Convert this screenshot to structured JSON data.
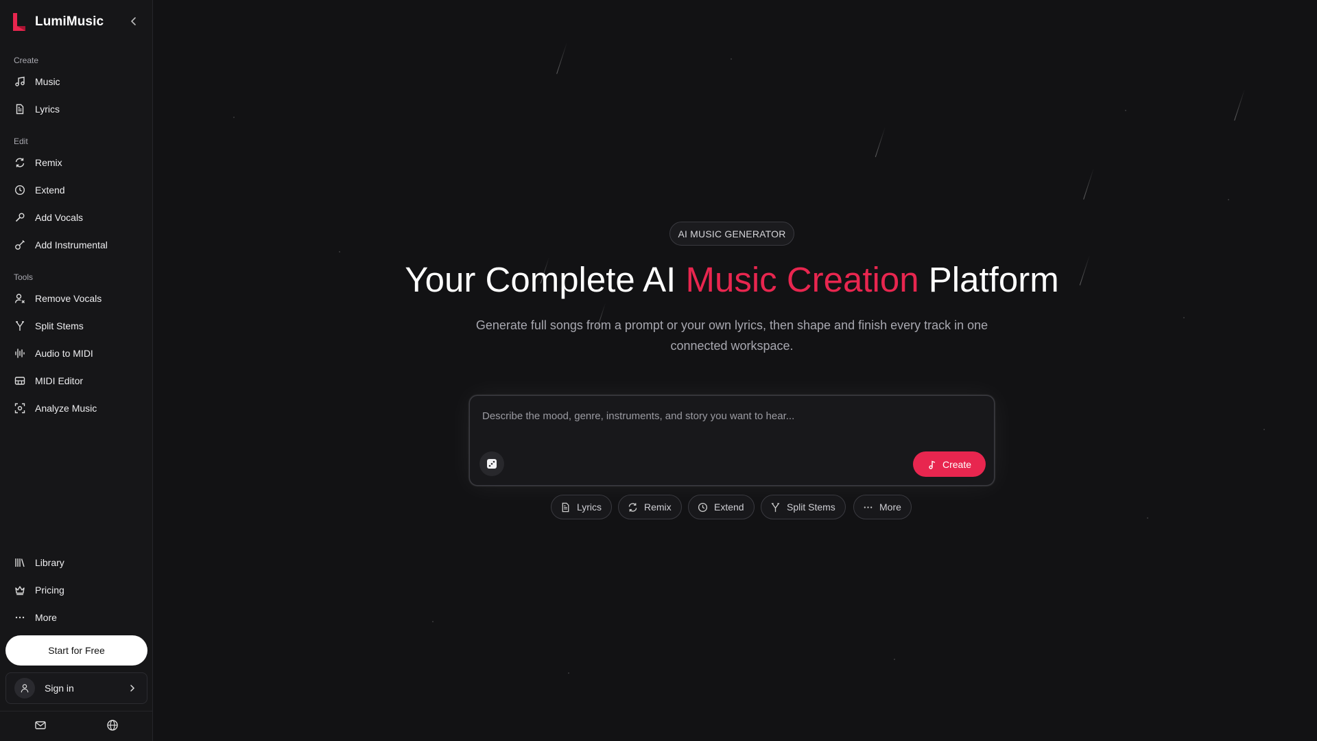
{
  "app": {
    "name": "LumiMusic"
  },
  "sidebar": {
    "sections": [
      {
        "title": "Create",
        "items": [
          {
            "label": "Music",
            "icon": "music-note-icon"
          },
          {
            "label": "Lyrics",
            "icon": "document-icon"
          }
        ]
      },
      {
        "title": "Edit",
        "items": [
          {
            "label": "Remix",
            "icon": "refresh-icon"
          },
          {
            "label": "Extend",
            "icon": "clock-icon"
          },
          {
            "label": "Add Vocals",
            "icon": "microphone-icon"
          },
          {
            "label": "Add Instrumental",
            "icon": "guitar-icon"
          }
        ]
      },
      {
        "title": "Tools",
        "items": [
          {
            "label": "Remove Vocals",
            "icon": "user-remove-icon"
          },
          {
            "label": "Split Stems",
            "icon": "split-icon"
          },
          {
            "label": "Audio to MIDI",
            "icon": "waveform-icon"
          },
          {
            "label": "MIDI Editor",
            "icon": "piano-icon"
          },
          {
            "label": "Analyze Music",
            "icon": "scan-icon"
          }
        ]
      }
    ],
    "bottom_items": [
      {
        "label": "Library",
        "icon": "library-icon"
      },
      {
        "label": "Pricing",
        "icon": "crown-icon"
      },
      {
        "label": "More",
        "icon": "ellipsis-icon"
      }
    ],
    "start_button": "Start for Free",
    "signin_label": "Sign in",
    "footer_icons": [
      "mail-icon",
      "globe-icon"
    ]
  },
  "hero": {
    "badge": "AI MUSIC GENERATOR",
    "title_part1": "Your Complete AI ",
    "title_accent": "Music Creation",
    "title_part2": " Platform",
    "subtitle": "Generate full songs from a prompt or your own lyrics, then shape and finish every track in one connected workspace.",
    "accent_color": "#e8264f"
  },
  "prompt": {
    "placeholder": "Describe the mood, genre, instruments, and story you want to hear...",
    "value": "",
    "create_label": "Create"
  },
  "chips": [
    {
      "label": "Lyrics",
      "icon": "document-icon"
    },
    {
      "label": "Remix",
      "icon": "refresh-icon"
    },
    {
      "label": "Extend",
      "icon": "clock-icon"
    },
    {
      "label": "Split Stems",
      "icon": "split-icon"
    },
    {
      "label": "More",
      "icon": "ellipsis-icon"
    }
  ]
}
